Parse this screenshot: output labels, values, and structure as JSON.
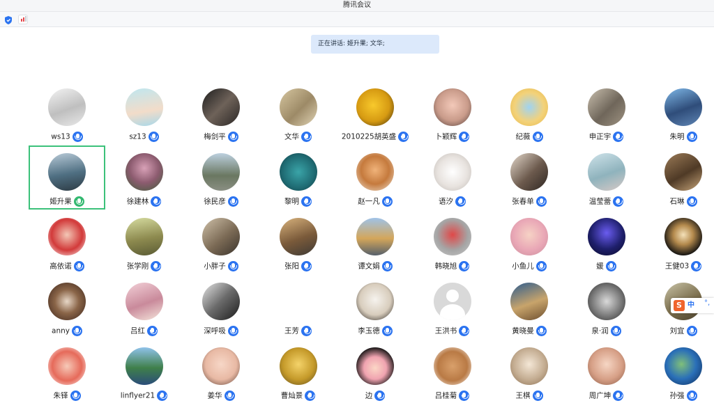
{
  "window": {
    "title": "腾讯会议"
  },
  "toolbar": {
    "icons": [
      "shield-icon",
      "signal-icon"
    ]
  },
  "speaking": {
    "label": "正在讲话: 姬升果; 文华;"
  },
  "colors": {
    "accent": "#2b73f0",
    "active_border": "#3bc17a",
    "speaking_bg": "#dce9fb"
  },
  "participants": [
    {
      "name": "ws13",
      "bg": "linear-gradient(160deg,#f3f3f3 0%,#bfbfbf 55%,#e9e9e9 100%)"
    },
    {
      "name": "sz13",
      "bg": "linear-gradient(170deg,#bfe7f0 0%,#f2dcc9 60%,#a6d8ea 100%)"
    },
    {
      "name": "梅剑平",
      "bg": "linear-gradient(135deg,#1d1d1d 0%,#6e6259 50%,#2a2624 100%)"
    },
    {
      "name": "文华",
      "bg": "linear-gradient(135deg,#d6c6a0 0%,#9d8a67 55%,#e1d5b6 100%)"
    },
    {
      "name": "2010225胡英盛",
      "bg": "radial-gradient(circle at 45% 45%,#f8c92c 0%,#d69a12 55%,#3a2a0c 100%)"
    },
    {
      "name": "卜颖辉",
      "bg": "radial-gradient(circle at 50% 45%,#f3c9b9 0%,#c99b8a 55%,#4f3c38 100%)"
    },
    {
      "name": "纪薇",
      "bg": "radial-gradient(circle at 50% 50%,#9fd3f2 0%,#f3d27a 55%,#e6b84a 100%)"
    },
    {
      "name": "申正宇",
      "bg": "linear-gradient(135deg,#c9bfae 0%,#6f665a 55%,#9e9382 100%)"
    },
    {
      "name": "朱明",
      "bg": "linear-gradient(160deg,#7fb8e8 0%,#2f4d7a 55%,#5f86b5 100%)"
    },
    {
      "name": "姬升果",
      "bg": "linear-gradient(170deg,#b9cbd8 0%,#4f6f82 55%,#2d3b44 100%)",
      "active": true
    },
    {
      "name": "徐建林",
      "bg": "radial-gradient(circle at 50% 40%,#d8a1b7 0%,#8c5b6f 50%,#3f5f3a 100%)"
    },
    {
      "name": "徐民彦",
      "bg": "linear-gradient(180deg,#bcd0df 0%,#6a7761 60%,#8a8f83 100%)"
    },
    {
      "name": "黎明",
      "bg": "radial-gradient(circle at 50% 50%,#3aa4a8 0%,#1f6b73 60%,#123b40 100%)"
    },
    {
      "name": "赵一凡",
      "bg": "radial-gradient(circle at 50% 45%,#f0b37a 0%,#c57a3d 50%,#efe4d6 100%)"
    },
    {
      "name": "语汐",
      "bg": "radial-gradient(circle at 50% 50%,#ffffff 0%,#e8e3df 55%,#bfbab5 100%)"
    },
    {
      "name": "张春单",
      "bg": "linear-gradient(135deg,#e4d9cc 0%,#6c5a4d 55%,#2e2622 100%)"
    },
    {
      "name": "温莹蕾",
      "bg": "linear-gradient(160deg,#cfe3ea 0%,#8fb3bd 55%,#d7c9c6 100%)"
    },
    {
      "name": "石琳",
      "bg": "linear-gradient(150deg,#9b7b57 0%,#4f3a26 55%,#c7a57a 100%)"
    },
    {
      "name": "高依诺",
      "bg": "radial-gradient(circle at 50% 45%,#f3c7b6 0%,#d23a3a 55%,#ffffff 100%)"
    },
    {
      "name": "张学刚",
      "bg": "linear-gradient(170deg,#d6dca0 0%,#8d8a4f 55%,#5a5b34 100%)"
    },
    {
      "name": "小胖子",
      "bg": "linear-gradient(140deg,#cfc1a9 0%,#7b6a55 55%,#3a332c 100%)"
    },
    {
      "name": "张阳",
      "bg": "linear-gradient(160deg,#d9b37d 0%,#7a5a3a 55%,#3e3a35 100%)"
    },
    {
      "name": "谭文娟",
      "bg": "linear-gradient(180deg,#9fc3e8 0%,#d4a65a 55%,#56606b 100%)"
    },
    {
      "name": "韩晓旭",
      "bg": "radial-gradient(circle at 50% 45%,#e04848 0%,#a5a5a5 55%,#c9c9c9 100%)"
    },
    {
      "name": "小鱼儿",
      "bg": "radial-gradient(circle at 50% 45%,#f6d2c5 0%,#e9a7b6 55%,#c98d9b 100%)"
    },
    {
      "name": "媛",
      "bg": "radial-gradient(circle at 50% 40%,#6a5cf0 0%,#1e1f6b 55%,#0b0b28 100%)"
    },
    {
      "name": "王健03",
      "bg": "radial-gradient(circle at 50% 45%,#f4e1b9 0%,#b48a4d 35%,#0f0f0f 75%)"
    },
    {
      "name": "anny",
      "bg": "radial-gradient(circle at 50% 50%,#e7d7c7 0%,#8a6548 45%,#3a231a 100%)"
    },
    {
      "name": "吕红",
      "bg": "linear-gradient(160deg,#f3d1d8 0%,#c98a9b 55%,#f5e6dc 100%)"
    },
    {
      "name": "深呼吸",
      "bg": "linear-gradient(135deg,#e6e6e6 0%,#6a6a6a 50%,#1b1b1b 100%)"
    },
    {
      "name": "王芳",
      "bg": "radial-gradient(circle at 50% 50%,#ffffff 0%,#ffffff 100%)"
    },
    {
      "name": "李玉德",
      "bg": "radial-gradient(circle at 50% 45%,#f6f3ee 0%,#d8cdbd 55%,#1e1a16 100%)"
    },
    {
      "name": "王洪书",
      "default": true
    },
    {
      "name": "黄晓曼",
      "bg": "linear-gradient(160deg,#2e5d8f 0%,#c8a46b 55%,#6d4f2f 100%)"
    },
    {
      "name": "泉·润",
      "bg": "radial-gradient(circle at 50% 50%,#d9d9d9 0%,#7a7a7a 55%,#2a2a2a 100%)"
    },
    {
      "name": "刘宜",
      "bg": "linear-gradient(150deg,#c9c4a8 0%,#7a6d4c 55%,#4b412d 100%)"
    },
    {
      "name": "朱铎",
      "bg": "radial-gradient(circle at 50% 50%,#f6c9b8 0%,#e66a5a 55%,#ffffff 100%)"
    },
    {
      "name": "linflyer21",
      "bg": "linear-gradient(180deg,#8fc2ea 0%,#3f7f4a 55%,#2b4d7a 100%)"
    },
    {
      "name": "姜华",
      "bg": "radial-gradient(circle at 50% 45%,#f7d7c7 0%,#e8b9a4 55%,#5a3d32 100%)"
    },
    {
      "name": "曹灿景",
      "bg": "radial-gradient(circle at 50% 45%,#f4d36a 0%,#c59a2a 55%,#5b4a1e 100%)"
    },
    {
      "name": "边",
      "bg": "radial-gradient(circle at 50% 55%,#fbd7c6 0%,#f0a3b0 40%,#111111 75%)"
    },
    {
      "name": "吕桂菊",
      "bg": "radial-gradient(circle at 50% 50%,#d9a06b 0%,#b97a45 55%,#ffffff 100%)"
    },
    {
      "name": "王棋",
      "bg": "radial-gradient(circle at 50% 45%,#f4e7d6 0%,#c4ad92 55%,#8a6f52 100%)"
    },
    {
      "name": "周广坤",
      "bg": "radial-gradient(circle at 50% 45%,#f6d6c4 0%,#d69f86 55%,#8a5a45 100%)"
    },
    {
      "name": "孙强",
      "bg": "radial-gradient(circle at 45% 45%,#7fbf7a 0%,#2a6fb8 50%,#0e2a55 100%)"
    }
  ],
  "ime": {
    "icon": "sogou-icon",
    "label": "中",
    "extra": "°,"
  }
}
